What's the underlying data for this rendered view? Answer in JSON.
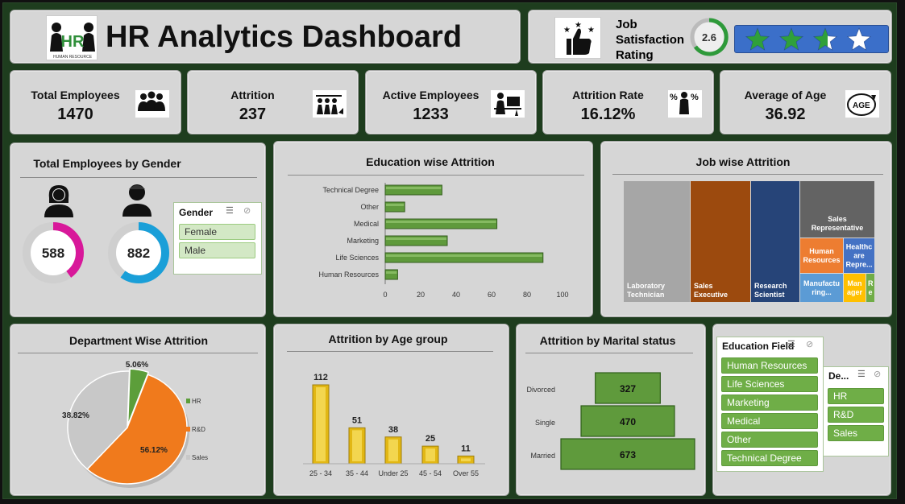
{
  "header": {
    "title": "HR Analytics Dashboard",
    "logo_text": "HR",
    "logo_sub": "HUMAN RESOURCE"
  },
  "rating": {
    "label_line1": "Job",
    "label_line2": "Satisfaction",
    "label_line3": "Rating",
    "value": "2.6",
    "stars_filled": 2.6,
    "stars_total": 4
  },
  "kpis": [
    {
      "label": "Total Employees",
      "value": "1470",
      "icon": "people-group-icon"
    },
    {
      "label": "Attrition",
      "value": "237",
      "icon": "people-leaving-icon"
    },
    {
      "label": "Active Employees",
      "value": "1233",
      "icon": "person-at-desk-icon"
    },
    {
      "label": "Attrition Rate",
      "value": "16.12%",
      "icon": "person-percent-icon"
    },
    {
      "label": "Average of Age",
      "value": "36.92",
      "icon": "age-arrow-icon"
    }
  ],
  "gender": {
    "title": "Total Employees by Gender",
    "female_value": "588",
    "male_value": "882",
    "female_fraction": 0.4,
    "male_fraction": 0.6,
    "slicer_title": "Gender",
    "slicer_items": [
      "Female",
      "Male"
    ]
  },
  "education_attrition": {
    "title": "Education wise Attrition",
    "chart_data": {
      "type": "bar",
      "categories": [
        "Technical Degree",
        "Other",
        "Medical",
        "Marketing",
        "Life Sciences",
        "Human Resources"
      ],
      "values": [
        32,
        11,
        63,
        35,
        89,
        7
      ],
      "xlim": [
        0,
        100
      ],
      "xticks": [
        "0",
        "20",
        "40",
        "60",
        "80",
        "100"
      ]
    }
  },
  "job_attrition": {
    "title": "Job wise Attrition",
    "chart_data": {
      "type": "treemap",
      "labels": [
        "Laboratory Technician",
        "Sales Executive",
        "Research Scientist",
        "Sales Representative",
        "Human Resources",
        "Healthcare Representative",
        "Manufacturing Director",
        "Manager",
        "Research Director"
      ],
      "display": [
        "Laboratory Technician",
        "Sales Executive",
        "Research Scientist",
        "Sales Representative",
        "Human Resources",
        "Healthc are Repre...",
        "Manufactu ring...",
        "Man ager",
        "R e"
      ]
    }
  },
  "department_attrition": {
    "title": "Department Wise Attrition",
    "chart_data": {
      "type": "pie",
      "labels": [
        "HR",
        "R&D",
        "Sales"
      ],
      "values": [
        5.06,
        56.12,
        38.82
      ],
      "value_labels": [
        "5.06%",
        "56.12%",
        "38.82%"
      ],
      "colors": [
        "#5c9e3a",
        "#f07a1c",
        "#c8c8c8"
      ],
      "legend_position": "right"
    }
  },
  "age_attrition": {
    "title": "Attrition by Age group",
    "chart_data": {
      "type": "bar",
      "categories": [
        "25 - 34",
        "35 - 44",
        "Under 25",
        "45 - 54",
        "Over 55"
      ],
      "values": [
        112,
        51,
        38,
        25,
        11
      ]
    }
  },
  "marital_attrition": {
    "title": "Attrition by Marital status",
    "chart_data": {
      "type": "bar",
      "categories": [
        "Divorced",
        "Single",
        "Married"
      ],
      "values": [
        327,
        470,
        673
      ]
    }
  },
  "education_slicer": {
    "title": "Education Field",
    "items": [
      "Human Resources",
      "Life Sciences",
      "Marketing",
      "Medical",
      "Other",
      "Technical Degree"
    ]
  },
  "department_slicer": {
    "title": "De...",
    "items": [
      "HR",
      "R&D",
      "Sales"
    ]
  },
  "colors": {
    "bar_green": "#5f9a3c",
    "bar_gold": "#e2b714",
    "donut_pink": "#d8189a",
    "donut_blue": "#1a9fd8",
    "star_bar_bg": "#3b6fc9"
  }
}
